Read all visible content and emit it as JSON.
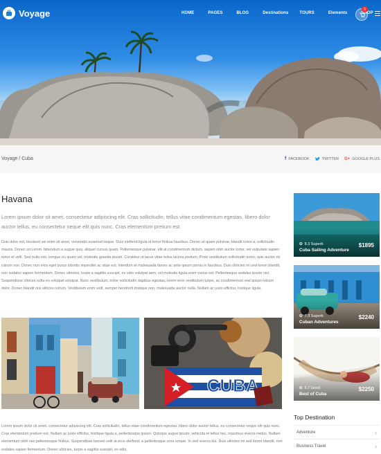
{
  "header": {
    "logo_text": "Voyage",
    "nav": [
      "HOME",
      "PAGES",
      "BLOG",
      "Destinations",
      "TOURS",
      "Elements",
      "SHOP"
    ],
    "cart_count": "0"
  },
  "breadcrumb": {
    "text": "Voyage / Cuba",
    "shares": [
      "FACEBOOK",
      "TWITTER",
      "GOOGLE PLUS"
    ]
  },
  "main": {
    "title": "Havana",
    "lead": "Lorem ipsum dolor sit amet, consectetur adipiscing elit. Cras sollicitudin, tellus vitae condimentum egestas, libero dolor auctor tellus, eu consectetur neque elit quis nunc. Cras elementum pretium est.",
    "paragraph": "Duis dolor est, tincidunt vel enim sit amet, venenatis euismod neque. Duis eleifend ligula id tortor finibus faucibus. Donec et quam pulvinar, blandit tortor a, sollicitudin mauris. Donec orci enim, bibendum a augue quis, aliquet cursus quam. Pellentesque pulvinar, elit at condimentum dictum, sapien nibh auctor tortor, vel vulputate sapien tortor et velit. Sed nulla nisi, congue eu quam vel, molestie gravida ipsum. Curabitur ut lacus vitae tellus lacinia pretium. Proin vestibulum sollicitudin tortor, quis auctor mi rutrum non. Donec non eros eget purus lobortis imperdiet ac vitae est. Interdum et malesuada fames ac ante ipsum primis in faucibus. Duis ultricies mi sed lorem blandit, non sodales sapien fermentum. Donec ultricies, turpis a sagittis suscipit, ex odio volutpat sem, vel molestie ligula enim varius est. Pellentesque sodales ipsum nisl. Suspendisse ultrices nulla eu volutpat volutpat. Nunc vestibulum, tortor sollicitudin dapibus egestas, lorem eros vestibulum turpis, ac condimentum erat ipsum rutrum dolor. Donec blandit nisi ultrices rutrum. Vestibulum enim velit, semper hendrerit tristique non, malesuada auctor nulla. Nullam ac justo efficitur, tristique ligula.",
    "paragraph2": "Lorem ipsum dolor sit amet, consectetur adipiscing elit. Cras sollicitudin, tellus vitae condimentum egestas, libero dolor auctor tellus, eu consectetur neque elit quis nunc. Cras elementum pretium est. Nullam ac justo efficitur, tristique ligula a, pellentesque ipsum. Quisque augue ipsum, vehicula et tellus nec, maximus viverra metus. Nullam elementum nibh nec pellentesque finibus. Suspendisse laoreet velit at eros eleifend, a pellentesque urna ornare. In sed viverra dui. Duis ultricies mi sed lorem blandit, non sodales sapien fermentum. Donec ultricies, turpis a sagittis suscipit, ex odio",
    "photo2_sign": "CUBA"
  },
  "sidebar": {
    "tours": [
      {
        "rating": "8.3 Superb",
        "name": "Cuba Sailing Adventure",
        "price": "$1895"
      },
      {
        "rating": "7.3 Superb",
        "name": "Cuban Adventures",
        "price": "$2240"
      },
      {
        "rating": "6.7 Good",
        "name": "Best of Cuba",
        "price": "$2250"
      }
    ],
    "top_destination_title": "Top Destination",
    "destinations": [
      "Adventure",
      "Business Travel"
    ]
  },
  "colors": {
    "accent": "#1b7fd6",
    "badge": "#e33333",
    "sky": "#2f8ce6"
  }
}
